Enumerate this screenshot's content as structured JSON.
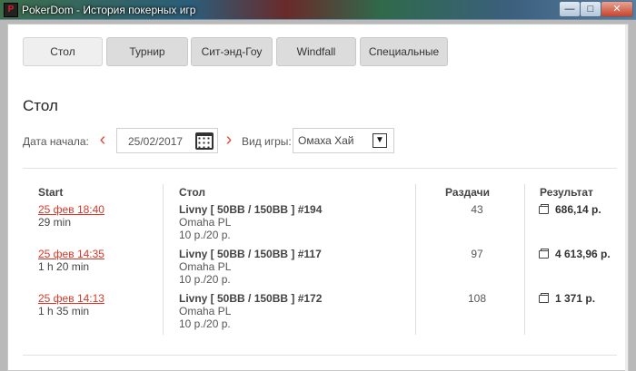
{
  "window": {
    "title": "PokerDom - История покерных игр",
    "icon_label": "P",
    "buttons": {
      "minimize": "—",
      "maximize": "□",
      "close": "✕"
    }
  },
  "tabs": [
    {
      "label": "Стол",
      "active": true
    },
    {
      "label": "Турнир",
      "active": false
    },
    {
      "label": "Сит-энд-Гоу",
      "active": false
    },
    {
      "label": "Windfall",
      "active": false
    },
    {
      "label": "Специальные",
      "active": false
    }
  ],
  "section": {
    "title": "Стол"
  },
  "filters": {
    "start_date_label": "Дата начала:",
    "start_date_value": "25/02/2017",
    "prev_icon": "chevron-left-icon",
    "next_icon": "chevron-right-icon",
    "game_type_label": "Вид игры:",
    "game_type_value": "Омаха Хай"
  },
  "table": {
    "headers": {
      "start": "Start",
      "table": "Стол",
      "hands": "Раздачи",
      "result": "Результат"
    },
    "rows": [
      {
        "start": "25 фев 18:40",
        "duration": "29 min",
        "table_name": "Livny [ 50BB / 150BB ] #194",
        "game": "Omaha PL",
        "stakes": "10 р./20 р.",
        "hands": "43",
        "result": "686,14 р."
      },
      {
        "start": "25 фев 14:35",
        "duration": "1 h 20 min",
        "table_name": "Livny [ 50BB / 150BB ] #117",
        "game": "Omaha PL",
        "stakes": "10 р./20 р.",
        "hands": "97",
        "result": "4 613,96 р."
      },
      {
        "start": "25 фев 14:13",
        "duration": "1 h 35 min",
        "table_name": "Livny [ 50BB / 150BB ] #172",
        "game": "Omaha PL",
        "stakes": "10 р./20 р.",
        "hands": "108",
        "result": "1 371 р."
      }
    ]
  },
  "colors": {
    "accent": "#e04b3a",
    "link": "#d9372a"
  }
}
